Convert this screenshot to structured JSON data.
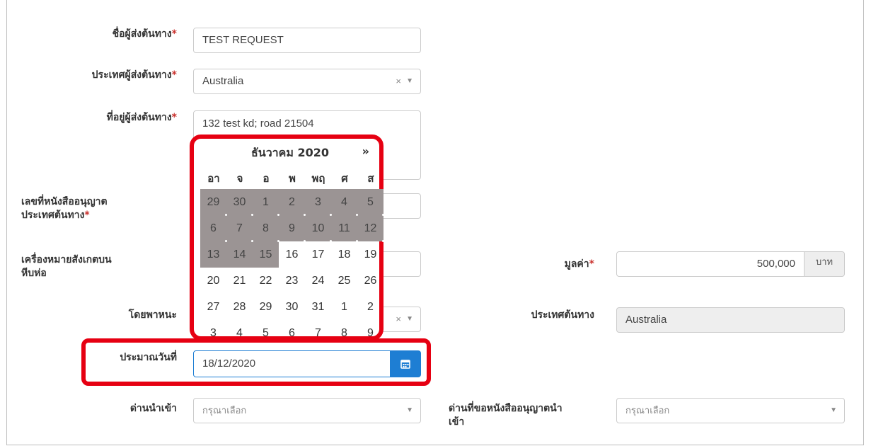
{
  "form": {
    "sender_name": {
      "label": "ชื่อผู้ส่งต้นทาง",
      "required": "*",
      "value": "TEST REQUEST"
    },
    "sender_country": {
      "label": "ประเทศผู้ส่งต้นทาง",
      "required": "*",
      "value": "Australia",
      "clear": "×",
      "arrow": "▼"
    },
    "sender_address": {
      "label": "ที่อยู่ผู้ส่งต้นทาง",
      "required": "*",
      "value": "132 test kd; road 21504"
    },
    "permit_number": {
      "label_line1": "เลขที่หนังสืออนุญาต",
      "label_line2": "ประเทศต้นทาง",
      "required": "*"
    },
    "package_mark": {
      "label_line1": "เครื่องหมายสังเกตบน",
      "label_line2": "หีบห่อ"
    },
    "vehicle": {
      "label": "โดยพาหนะ",
      "clear": "×",
      "arrow": "▼"
    },
    "estimated_date": {
      "label": "ประมาณวันที่",
      "value": "18/12/2020"
    },
    "import_port": {
      "label": "ด่านนำเข้า",
      "placeholder": "กรุณาเลือก",
      "arrow": "▼"
    },
    "value": {
      "label": "มูลค่า",
      "required": "*",
      "value": "500,000",
      "unit": "บาท"
    },
    "origin_country": {
      "label": "ประเทศต้นทาง",
      "value": "Australia"
    },
    "permit_port": {
      "label_line1": "ด่านที่ขอหนังสืออนุญาตนำ",
      "label_line2": "เข้า",
      "placeholder": "กรุณาเลือก",
      "arrow": "▼"
    }
  },
  "datepicker": {
    "title": "ธันวาคม 2020",
    "next": "»",
    "weekdays": [
      "อา",
      "จ",
      "อ",
      "พ",
      "พฤ",
      "ศ",
      "ส"
    ],
    "days": [
      "29",
      "30",
      "1",
      "2",
      "3",
      "4",
      "5",
      "6",
      "7",
      "8",
      "9",
      "10",
      "11",
      "12",
      "13",
      "14",
      "15",
      "16",
      "17",
      "18",
      "19",
      "20",
      "21",
      "22",
      "23",
      "24",
      "25",
      "26",
      "27",
      "28",
      "29",
      "30",
      "31",
      "1",
      "2",
      "3",
      "4",
      "5",
      "6",
      "7",
      "8",
      "9"
    ],
    "disabled_count": 17
  },
  "colors": {
    "accent": "#1e7ed3",
    "highlight": "#e60012",
    "disabled_day": "#9b9494",
    "required": "#c9302c"
  }
}
